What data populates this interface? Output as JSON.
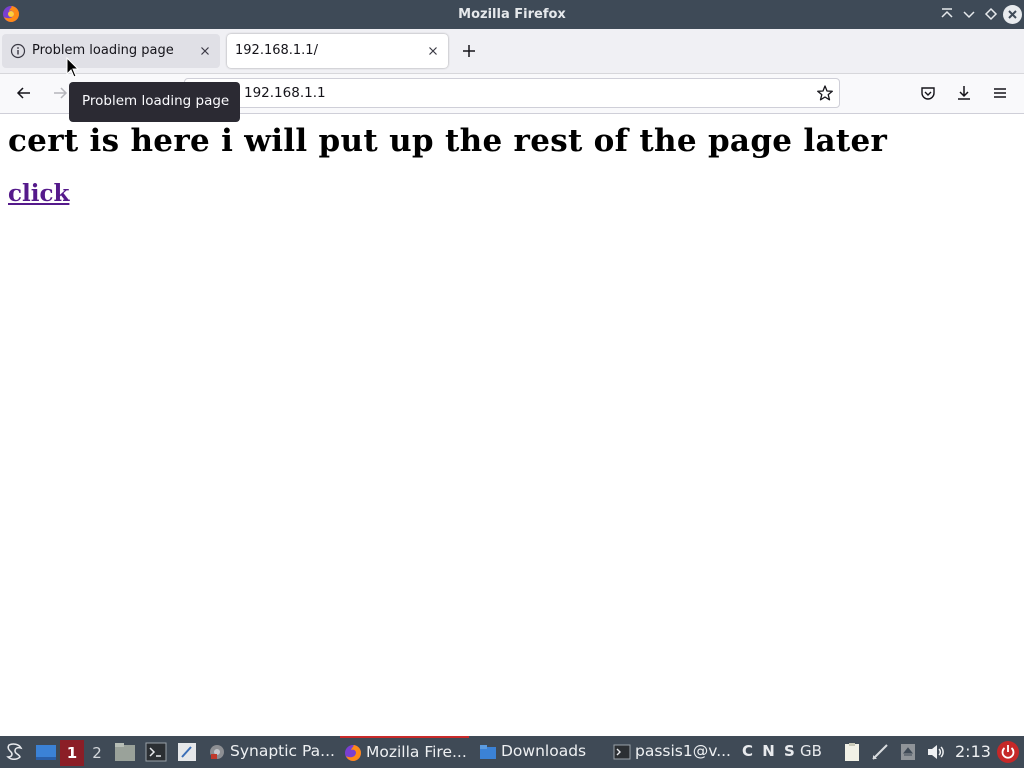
{
  "window": {
    "title": "Mozilla Firefox"
  },
  "tabs": [
    {
      "label": "Problem loading page",
      "icon": "info-icon",
      "active": false
    },
    {
      "label": "192.168.1.1/",
      "active": true
    }
  ],
  "navbar": {
    "url": "192.168.1.1"
  },
  "tooltip": {
    "text": "Problem loading page"
  },
  "page": {
    "heading": "cert is here i will put up the rest of the page later",
    "link_text": "click",
    "link_color": "#551a8b"
  },
  "taskbar": {
    "workspaces": [
      "1",
      "2"
    ],
    "tasks": [
      {
        "label": "Synaptic Pa...",
        "icon": "package-manager-icon"
      },
      {
        "label": "Mozilla Fire...",
        "icon": "firefox-icon",
        "active": true
      },
      {
        "label": "Downloads",
        "icon": "folder-icon"
      },
      {
        "label": "passis1@v...",
        "icon": "terminal-icon"
      }
    ],
    "keyboard_indicators": "C N S",
    "keyboard_layout": "GB",
    "clock": "2:13"
  },
  "colors": {
    "titlebar": "#3e4a57",
    "taskbar": "#3f4a56",
    "active_workspace": "#8b1e26"
  }
}
